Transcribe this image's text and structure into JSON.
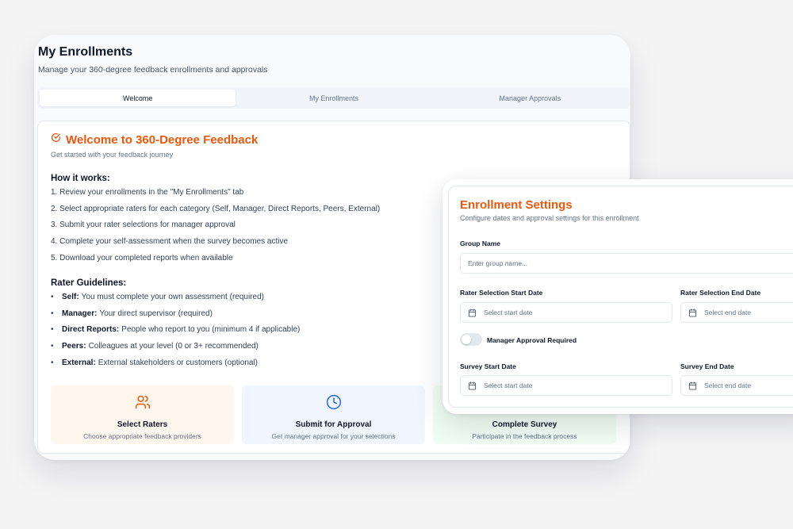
{
  "header": {
    "title": "My Enrollments",
    "subtitle": "Manage your 360-degree feedback enrollments and approvals"
  },
  "tabs": [
    {
      "label": "Welcome",
      "active": true
    },
    {
      "label": "My Enrollments",
      "active": false
    },
    {
      "label": "Manager Approvals",
      "active": false
    }
  ],
  "welcome": {
    "title": "Welcome to 360-Degree Feedback",
    "subtitle": "Get started with your feedback journey",
    "how_title": "How it works:",
    "steps": [
      "1. Review your enrollments in the \"My Enrollments\" tab",
      "2. Select appropriate raters for each category (Self, Manager, Direct Reports, Peers, External)",
      "3. Submit your rater selections for manager approval",
      "4. Complete your self-assessment when the survey becomes active",
      "5. Download your completed reports when available"
    ],
    "guidelines_title": "Rater Guidelines:",
    "guidelines": [
      {
        "term": "Self:",
        "text": "You must complete your own assessment (required)"
      },
      {
        "term": "Manager:",
        "text": "Your direct supervisor (required)"
      },
      {
        "term": "Direct Reports:",
        "text": "People who report to you (minimum 4 if applicable)"
      },
      {
        "term": "Peers:",
        "text": "Colleagues at your level (0 or 3+ recommended)"
      },
      {
        "term": "External:",
        "text": "External stakeholders or customers (optional)"
      }
    ],
    "features": [
      {
        "title": "Select Raters",
        "desc": "Choose appropriate feedback providers",
        "icon": "users-icon"
      },
      {
        "title": "Submit for Approval",
        "desc": "Get manager approval for your selections",
        "icon": "clock-icon"
      },
      {
        "title": "Complete Survey",
        "desc": "Participate in the feedback process",
        "icon": "check-icon"
      }
    ]
  },
  "settings": {
    "title": "Enrollment Settings",
    "subtitle": "Configure dates and approval settings for this enrollment",
    "group_name_label": "Group Name",
    "group_name_placeholder": "Enter group name...",
    "rater_start_label": "Rater Selection Start Date",
    "rater_end_label": "Rater Selection End Date",
    "start_placeholder": "Select start date",
    "end_placeholder": "Select end date",
    "approval_label": "Manager Approval Required",
    "approval_enabled": false,
    "survey_start_label": "Survey Start Date",
    "survey_end_label": "Survey End Date"
  },
  "colors": {
    "accent": "#ea580c",
    "blue_icon": "#2563eb"
  }
}
